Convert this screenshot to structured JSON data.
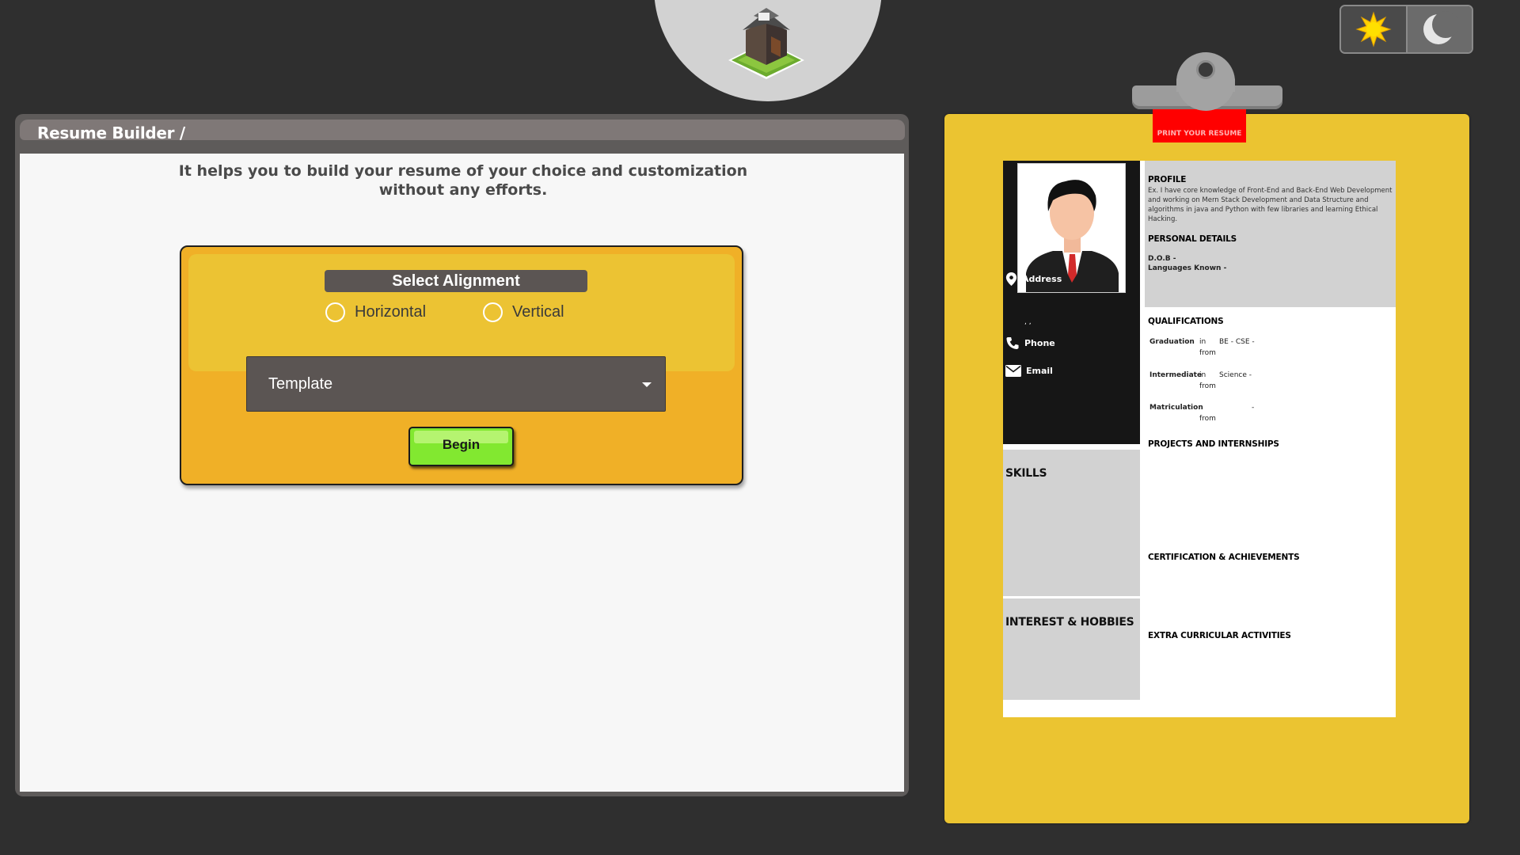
{
  "logo": {
    "icon": "house-icon"
  },
  "theme": {
    "light_icon": "sun-icon",
    "dark_icon": "moon-icon"
  },
  "builder": {
    "title": "Resume Builder /",
    "intro": "It helps you to build your resume of your choice and customization without any efforts.",
    "alignment_title": "Select Alignment",
    "option_horizontal": "Horizontal",
    "option_vertical": "Vertical",
    "template_selected": "Template",
    "begin_label": "Begin"
  },
  "resume": {
    "print_label": "PRINT YOUR RESUME",
    "address_label": "Address",
    "address_value": ", ,",
    "phone_label": "Phone",
    "email_label": "Email",
    "skills_label": "SKILLS",
    "interest_label": "INTEREST & HOBBIES",
    "profile_label": "PROFILE",
    "profile_text": "Ex. I have core knowledge of Front-End and Back-End Web Development and working on Mern Stack Development and Data Structure and algorithms in java and Python with few libraries and learning Ethical Hacking.",
    "personal_label": "PERSONAL DETAILS",
    "dob_label": "D.O.B -",
    "languages_label": "Languages Known -",
    "qualifications_label": "QUALIFICATIONS",
    "qualifications": [
      {
        "level": "Graduation",
        "in": "in",
        "field": "BE - CSE -",
        "from": "from"
      },
      {
        "level": "Intermediate",
        "in": "in",
        "field": "Science -",
        "from": "from"
      },
      {
        "level": "Matriculation",
        "in": "",
        "field": "-",
        "from": "from"
      }
    ],
    "projects_label": "PROJECTS AND INTERNSHIPS",
    "certification_label": "CERTIFICATION & ACHIEVEMENTS",
    "extra_label": "EXTRA CURRICULAR ACTIVITIES"
  },
  "colors": {
    "background": "#2f2f2f",
    "accent_yellow": "#ebc431",
    "form_orange": "#f0b027",
    "button_green": "#82e830",
    "print_red": "#ff0000"
  }
}
